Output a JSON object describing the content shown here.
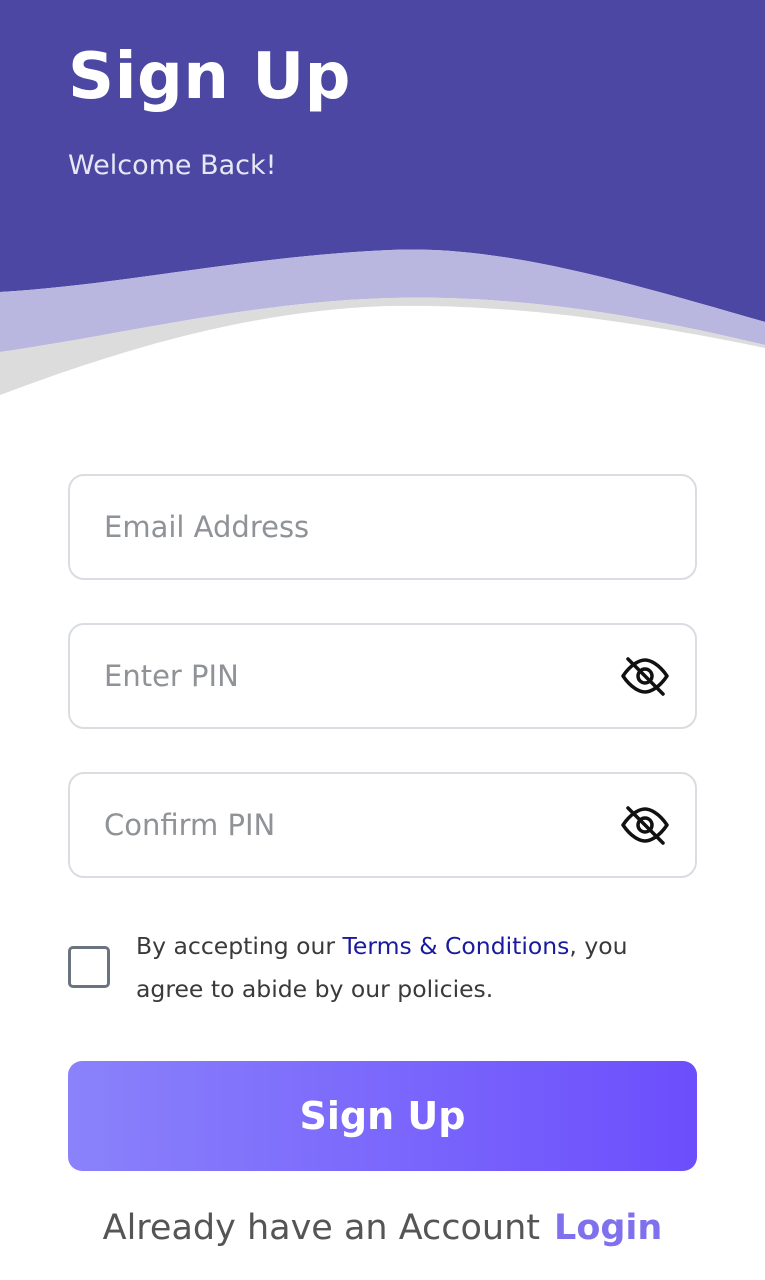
{
  "header": {
    "title": "Sign Up",
    "subtitle": "Welcome Back!",
    "colors": {
      "primary": "#4b47a3",
      "wave_light": "#b9b6e0",
      "wave_grey": "#dcdcdc"
    }
  },
  "form": {
    "email": {
      "placeholder": "Email Address",
      "value": ""
    },
    "pin": {
      "placeholder": "Enter PIN",
      "value": "",
      "icon": "eye-off-icon"
    },
    "confirm_pin": {
      "placeholder": "Confirm PIN",
      "value": "",
      "icon": "eye-off-icon"
    },
    "terms": {
      "checked": false,
      "prefix": "By accepting our ",
      "link": "Terms & Conditions",
      "suffix": ", you agree to abide by our policies."
    },
    "submit_label": "Sign Up",
    "submit_gradient": [
      "#8a82fb",
      "#6c4efc"
    ]
  },
  "footer": {
    "prompt": "Already have an Account",
    "login_label": "Login",
    "login_color": "#7f70ee"
  }
}
